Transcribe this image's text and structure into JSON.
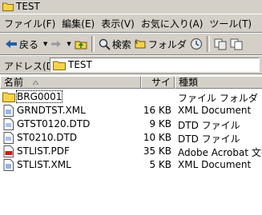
{
  "window": {
    "title": "TEST"
  },
  "menu": [
    {
      "label": "ファイル(F)"
    },
    {
      "label": "編集(E)"
    },
    {
      "label": "表示(V)"
    },
    {
      "label": "お気に入り(A)"
    },
    {
      "label": "ツール(T)"
    }
  ],
  "toolbar": {
    "back_label": "戻る",
    "search_label": "検索",
    "folders_label": "フォルダ"
  },
  "address": {
    "label": "アドレス(D)",
    "value": "TEST"
  },
  "columns": {
    "name": "名前",
    "size": "サイズ",
    "type": "種類"
  },
  "files": [
    {
      "name": "BRG0001",
      "size": "",
      "type": "ファイル フォルダ",
      "icon": "folder-icon"
    },
    {
      "name": "GRNDTST.XML",
      "size": "16 KB",
      "type": "XML Document",
      "icon": "xml-document-icon"
    },
    {
      "name": "GTST0120.DTD",
      "size": "9 KB",
      "type": "DTD ファイル",
      "icon": "dtd-file-icon"
    },
    {
      "name": "ST0210.DTD",
      "size": "10 KB",
      "type": "DTD ファイル",
      "icon": "dtd-file-icon"
    },
    {
      "name": "STLIST.PDF",
      "size": "35 KB",
      "type": "Adobe Acrobat 文書",
      "icon": "pdf-file-icon"
    },
    {
      "name": "STLIST.XML",
      "size": "5 KB",
      "type": "XML Document",
      "icon": "xml-document-icon"
    }
  ],
  "colors": {
    "chrome": "#d4d0c8",
    "folder": "#f5d24a"
  }
}
